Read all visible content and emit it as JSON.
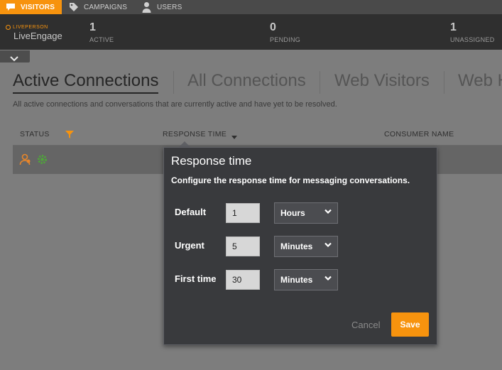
{
  "topnav": {
    "items": [
      {
        "label": "VISITORS",
        "icon": "chat-bubble-icon"
      },
      {
        "label": "CAMPAIGNS",
        "icon": "tag-icon"
      },
      {
        "label": "USERS",
        "icon": "user-icon"
      }
    ]
  },
  "brand": {
    "top": "LIVEPERSON",
    "main": "LiveEngage"
  },
  "stats": [
    {
      "value": "1",
      "label": "ACTIVE"
    },
    {
      "value": "0",
      "label": "PENDING"
    },
    {
      "value": "1",
      "label": "UNASSIGNED"
    }
  ],
  "tabs": [
    "Active Connections",
    "All Connections",
    "Web Visitors",
    "Web H"
  ],
  "subtitle": "All active connections and conversations that are currently active and have yet to be resolved.",
  "table": {
    "headers": {
      "status": "STATUS",
      "response_time": "RESPONSE TIME",
      "consumer_name": "CONSUMER NAME"
    }
  },
  "popup": {
    "title": "Response time",
    "description": "Configure the response time for messaging conversations.",
    "fields": [
      {
        "label": "Default",
        "value": "1",
        "unit": "Hours"
      },
      {
        "label": "Urgent",
        "value": "5",
        "unit": "Minutes"
      },
      {
        "label": "First time",
        "value": "30",
        "unit": "Minutes"
      }
    ],
    "cancel": "Cancel",
    "save": "Save"
  },
  "colors": {
    "accent": "#f7930e"
  }
}
